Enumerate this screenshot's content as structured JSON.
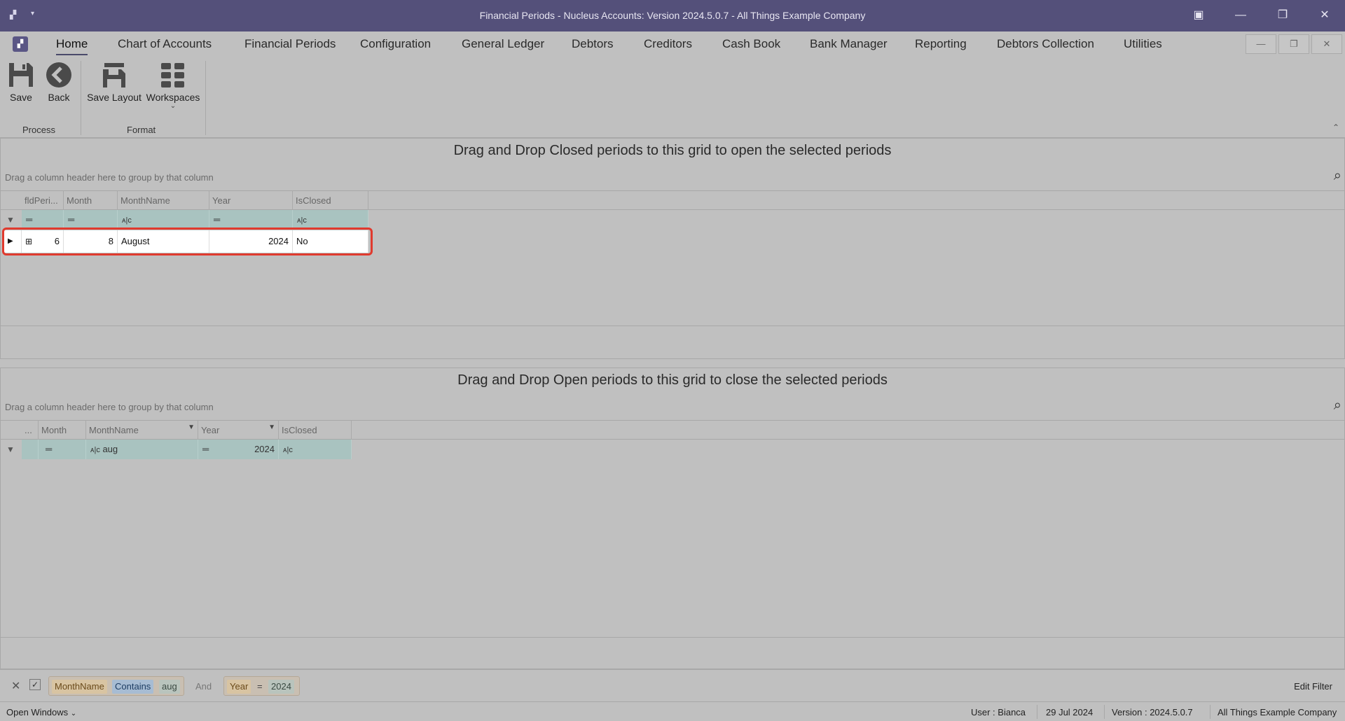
{
  "window": {
    "title": "Financial Periods - Nucleus Accounts: Version 2024.5.0.7 - All Things Example Company",
    "app_icon": "app-logo-icon"
  },
  "ribbon_tabs": [
    "Home",
    "Chart of Accounts",
    "Financial Periods",
    "Configuration",
    "General Ledger",
    "Debtors",
    "Creditors",
    "Cash Book",
    "Bank Manager",
    "Reporting",
    "Debtors Collection",
    "Utilities"
  ],
  "ribbon": {
    "save_label": "Save",
    "back_label": "Back",
    "save_layout_label": "Save Layout",
    "workspaces_label": "Workspaces",
    "process_group": "Process",
    "format_group": "Format"
  },
  "closed_panel": {
    "caption": "Drag and Drop Closed periods to this grid to open the selected periods",
    "group_hint": "Drag a column header here to group by that column",
    "columns": [
      "fldPeri...",
      "Month",
      "MonthName",
      "Year",
      "IsClosed"
    ],
    "row": {
      "id": "6",
      "month": "8",
      "month_name": "August",
      "year": "2024",
      "is_closed": "No"
    }
  },
  "open_panel": {
    "caption": "Drag and Drop Open periods to this grid to close the selected periods",
    "group_hint": "Drag a column header here to group by that column",
    "columns": [
      "...",
      "Month",
      "MonthName",
      "Year",
      "IsClosed"
    ],
    "filter": {
      "month_name": "aug",
      "year": "2024"
    }
  },
  "filter_bar": {
    "field1": "MonthName",
    "op1": "Contains",
    "value1": "aug",
    "and_label": "And",
    "field2": "Year",
    "op2": "=",
    "value2": "2024",
    "edit_label": "Edit Filter"
  },
  "status_bar": {
    "open_windows": "Open Windows",
    "user": "User : Bianca",
    "date": "29 Jul 2024",
    "version": "Version : 2024.5.0.7",
    "company": "All Things Example Company"
  },
  "colors": {
    "title_bar": "#54507a",
    "filter_row": "#a9c3c0",
    "highlight": "#e03a2e"
  }
}
